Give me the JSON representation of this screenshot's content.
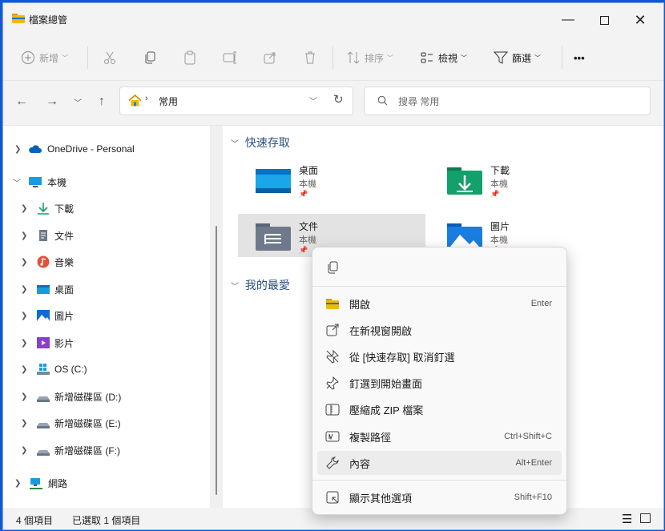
{
  "window": {
    "title": "檔案總管"
  },
  "toolbar": {
    "new": "新增",
    "sort": "排序",
    "view": "檢視",
    "filter": "篩選",
    "more": "•••"
  },
  "address": {
    "path": "常用",
    "search_placeholder": "搜尋 常用"
  },
  "nav": [
    {
      "label": "OneDrive - Personal",
      "icon": "cloud-icon"
    },
    {
      "label": "本機",
      "icon": "computer-icon"
    },
    {
      "label": "下載",
      "icon": "download-icon"
    },
    {
      "label": "文件",
      "icon": "document-icon"
    },
    {
      "label": "音樂",
      "icon": "music-icon"
    },
    {
      "label": "桌面",
      "icon": "desktop-icon"
    },
    {
      "label": "圖片",
      "icon": "pictures-icon"
    },
    {
      "label": "影片",
      "icon": "videos-icon"
    },
    {
      "label": "OS (C:)",
      "icon": "windows-drive-icon"
    },
    {
      "label": "新增磁碟區 (D:)",
      "icon": "drive-icon"
    },
    {
      "label": "新增磁碟區 (E:)",
      "icon": "drive-icon"
    },
    {
      "label": "新增磁碟區 (F:)",
      "icon": "drive-icon"
    },
    {
      "label": "網路",
      "icon": "network-icon"
    }
  ],
  "quick_access": {
    "heading": "快速存取",
    "items": [
      {
        "name": "桌面",
        "location": "本機"
      },
      {
        "name": "下載",
        "location": "本機"
      },
      {
        "name": "文件",
        "location": "本機"
      },
      {
        "name": "圖片",
        "location": "本機"
      }
    ]
  },
  "favorites": {
    "heading": "我的最愛"
  },
  "status": {
    "count": "4 個項目",
    "selected": "已選取 1 個項目"
  },
  "context_menu": {
    "items": [
      {
        "label": "開啟",
        "shortcut": "Enter"
      },
      {
        "label": "在新視窗開啟",
        "shortcut": ""
      },
      {
        "label": "從 [快速存取] 取消釘選",
        "shortcut": ""
      },
      {
        "label": "釘選到開始畫面",
        "shortcut": ""
      },
      {
        "label": "壓縮成 ZIP 檔案",
        "shortcut": ""
      },
      {
        "label": "複製路徑",
        "shortcut": "Ctrl+Shift+C"
      },
      {
        "label": "內容",
        "shortcut": "Alt+Enter"
      },
      {
        "label": "顯示其他選項",
        "shortcut": "Shift+F10"
      }
    ]
  },
  "colors": {
    "accent": "#0067c0",
    "folder": "#f5b800",
    "selection": "#cce4f7"
  }
}
